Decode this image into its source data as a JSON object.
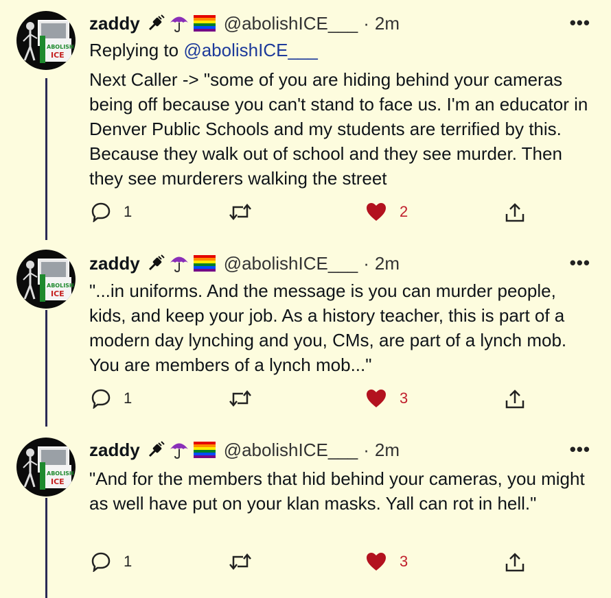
{
  "tweets": [
    {
      "name": "zaddy",
      "handle": "@abolishICE___",
      "separator": "·",
      "time": "2m",
      "replying_prefix": "Replying to",
      "replying_to": "@abolishICE___",
      "text": "Next Caller -> \"some of you are hiding behind your cameras being off because you can't stand to face us. I'm an educator in Denver Public Schools and my students are terrified by this. Because they walk out of school and they see murder. Then they see murderers walking the street",
      "replies": "1",
      "likes": "2"
    },
    {
      "name": "zaddy",
      "handle": "@abolishICE___",
      "separator": "·",
      "time": "2m",
      "text": "\"...in uniforms. And the message is you can murder people, kids, and keep your job. As a history teacher, this is part of a modern day lynching and you, CMs, are part of a lynch mob. You are members of a lynch mob...\"",
      "replies": "1",
      "likes": "3"
    },
    {
      "name": "zaddy",
      "handle": "@abolishICE___",
      "separator": "·",
      "time": "2m",
      "text": "\"And for the members that hid behind your cameras, you might as well have put on your klan masks. Yall can rot in hell.\"",
      "replies": "1",
      "likes": "3"
    }
  ],
  "avatar_text": {
    "line1": "ABOLISH",
    "line2": "ICE"
  },
  "more_label": "•••",
  "icons": {
    "emoji": [
      "plug-icon",
      "umbrella-icon",
      "rainbow-flag-icon"
    ],
    "actions": [
      "reply-icon",
      "retweet-icon",
      "heart-icon",
      "share-icon"
    ]
  },
  "colors": {
    "background": "#fdfcde",
    "like": "#c0202d",
    "mention": "#1d3a9a",
    "thread_line": "#2a2a55"
  }
}
